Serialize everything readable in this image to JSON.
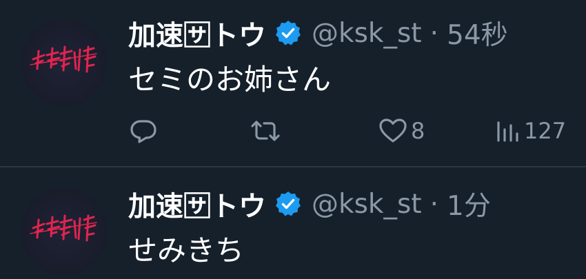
{
  "tweets": [
    {
      "display_name": "加速🈂トウ",
      "handle": "@ksk_st",
      "separator": "·",
      "time": "54秒",
      "text": "セミのお姉さん",
      "avatar_icon": "avatar-logo-icon",
      "verified_icon": "verified-badge-icon",
      "actions": {
        "reply": {
          "icon": "reply-icon",
          "count": ""
        },
        "retweet": {
          "icon": "retweet-icon",
          "count": ""
        },
        "like": {
          "icon": "heart-icon",
          "count": "8"
        },
        "views": {
          "icon": "views-chart-icon",
          "count": "127"
        }
      }
    },
    {
      "display_name": "加速🈂トウ",
      "handle": "@ksk_st",
      "separator": "·",
      "time": "1分",
      "text": "せみきち",
      "avatar_icon": "avatar-logo-icon",
      "verified_icon": "verified-badge-icon"
    }
  ],
  "colors": {
    "background": "#15202b",
    "text_primary": "#ffffff",
    "text_secondary": "#8b98a5",
    "verified": "#1d9bf0",
    "avatar_logo": "#e0244f",
    "divider": "#2a3640"
  }
}
